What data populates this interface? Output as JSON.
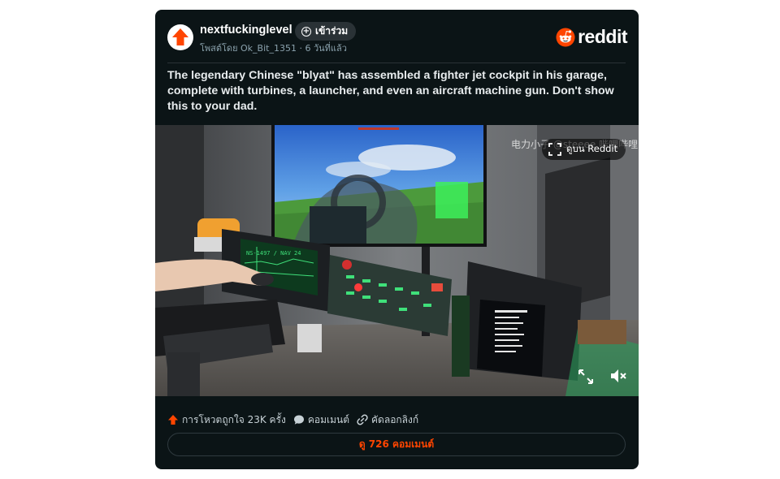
{
  "post": {
    "subreddit": "nextfuckinglevel",
    "join_label": "เข้าร่วม",
    "posted_prefix": "โพสต์โดย",
    "author": "Ok_Bit_1351",
    "separator": "·",
    "age": "6 วันที่แล้ว",
    "brand": "reddit",
    "title": "The legendary Chinese \"blyat\" has assembled a fighter jet cockpit in his garage, complete with turbines, a launcher, and even an aircraft machine gun. Don't show this to your dad."
  },
  "video": {
    "watermark": "电力小子 @steeee 哔哩哔哩",
    "watch_label": "ดูบน Reddit",
    "hud_readout": "NS-1497 / NAV 24"
  },
  "footer": {
    "upvotes_label": "การโหวตถูกใจ 23K ครั้ง",
    "comment_label": "คอมเมนต์",
    "copy_link_label": "คัดลอกลิงก์",
    "view_comments_label": "ดู 726 คอมเมนต์"
  },
  "colors": {
    "card_bg": "#0b1416",
    "accent": "#ff4500",
    "text": "#e8ecee",
    "muted": "#8ba2ad"
  },
  "icons": {
    "subreddit": "upvote-arrow-icon",
    "join": "plus-circle-icon",
    "brand": "reddit-snoo-icon",
    "watch": "fullscreen-corners-icon",
    "expand": "expand-arrows-icon",
    "mute": "speaker-muted-icon",
    "upvote": "upvote-arrow-icon",
    "comment": "comment-bubble-icon",
    "copy_link": "link-icon"
  }
}
